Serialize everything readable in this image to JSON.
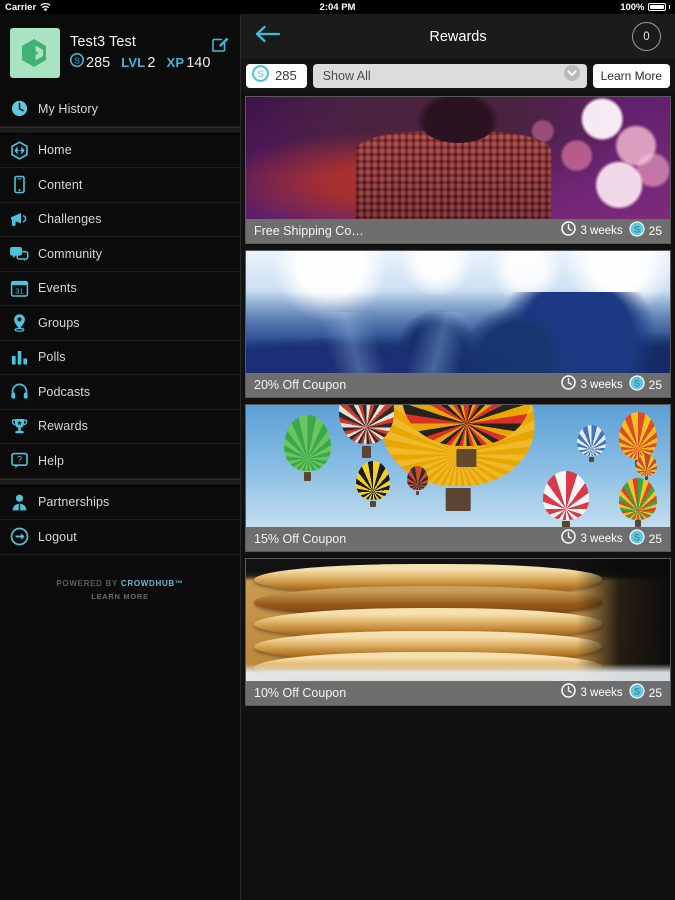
{
  "statusbar": {
    "carrier": "Carrier",
    "wifi_icon": "wifi-icon",
    "time": "2:04 PM",
    "battery_percent": "100%",
    "battery_icon": "battery-full-icon"
  },
  "sidebar": {
    "profile": {
      "avatar_icon": "hexagon-logo-icon",
      "avatar_bg": "#a9e3c1",
      "name": "Test3 Test",
      "edit_icon": "edit-pencil-icon",
      "stats": [
        {
          "icon": "coin-icon",
          "label": "",
          "value": "285"
        },
        {
          "icon": "",
          "label": "LVL",
          "value": "2"
        },
        {
          "icon": "",
          "label": "XP",
          "value": "140"
        }
      ]
    },
    "items": [
      {
        "label": "My History",
        "icon": "clock-icon"
      },
      {
        "label": "Home",
        "icon": "hexagon-home-icon"
      },
      {
        "label": "Content",
        "icon": "phone-icon"
      },
      {
        "label": "Challenges",
        "icon": "megaphone-icon"
      },
      {
        "label": "Community",
        "icon": "chat-bubbles-icon"
      },
      {
        "label": "Events",
        "icon": "calendar-31-icon"
      },
      {
        "label": "Groups",
        "icon": "map-pin-icon"
      },
      {
        "label": "Polls",
        "icon": "bar-chart-icon"
      },
      {
        "label": "Podcasts",
        "icon": "headphones-icon"
      },
      {
        "label": "Rewards",
        "icon": "trophy-icon"
      },
      {
        "label": "Help",
        "icon": "question-bubble-icon"
      },
      {
        "label": "Partnerships",
        "icon": "person-icon"
      },
      {
        "label": "Logout",
        "icon": "logout-arrow-icon"
      }
    ],
    "footer": {
      "powered_by": "POWERED BY",
      "brand": "CROWDHUB™",
      "learn_more": "LEARN MORE"
    }
  },
  "main": {
    "navbar": {
      "back_icon": "back-arrow-icon",
      "title": "Rewards",
      "badge_count": "0"
    },
    "filterbar": {
      "coin_icon": "coin-icon",
      "balance": "285",
      "filter_value": "Show All",
      "chevron_icon": "chevron-down-icon",
      "learn_more_label": "Learn More"
    },
    "cards": [
      {
        "title": "Free Shipping Co…",
        "clock_icon": "clock-icon",
        "duration": "3 weeks",
        "coin_icon": "coin-icon",
        "cost": "25",
        "image": "concert-singer-purple"
      },
      {
        "title": "20% Off Coupon",
        "clock_icon": "clock-icon",
        "duration": "3 weeks",
        "coin_icon": "coin-icon",
        "cost": "25",
        "image": "concert-crowd-blue"
      },
      {
        "title": "15% Off Coupon",
        "clock_icon": "clock-icon",
        "duration": "3 weeks",
        "coin_icon": "coin-icon",
        "cost": "25",
        "image": "hot-air-balloons"
      },
      {
        "title": "10% Off Coupon",
        "clock_icon": "clock-icon",
        "duration": "3 weeks",
        "coin_icon": "coin-icon",
        "cost": "25",
        "image": "pancake-stack"
      }
    ]
  },
  "colors": {
    "accent_cyan": "#4cc3dd",
    "sidebar_bg": "#0b0b0b",
    "navbar_bg": "#1b1b1b",
    "caption_bg": "#6e6e6e",
    "avatar_green": "#a9e3c1"
  }
}
